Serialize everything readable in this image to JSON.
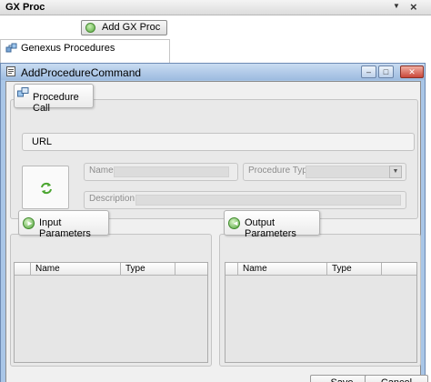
{
  "panel": {
    "title": "GX Proc",
    "menu_glyph": "▼",
    "close_glyph": "×",
    "add_button_label": "Add GX Proc",
    "tree_item": "Genexus Procedures"
  },
  "dialog": {
    "title": "AddProcedureCommand",
    "minimize_glyph": "–",
    "maximize_glyph": "□",
    "close_glyph": "✕",
    "procedure_call": {
      "tab_label": "Procedure Call",
      "url_label": "URL",
      "name_label": "Name",
      "name_value": "",
      "procedure_type_label": "Procedure Type",
      "procedure_type_value": "",
      "description_label": "Description",
      "description_value": ""
    },
    "input_parameters": {
      "tab_label": "Input Parameters",
      "columns": [
        "Name",
        "Type"
      ]
    },
    "output_parameters": {
      "tab_label": "Output Parameters",
      "columns": [
        "Name",
        "Type"
      ]
    },
    "buttons": {
      "save": "Save",
      "cancel": "Cancel"
    }
  },
  "icons": {
    "add": "add-circle-icon",
    "tree": "procedures-icon",
    "dialog": "command-icon",
    "refresh": "refresh-icon",
    "input": "arrow-right-icon",
    "output": "arrow-left-icon"
  },
  "colors": {
    "dialog_frame": "#a9c6e7",
    "dialog_client": "#f0f0f0",
    "close_button": "#c9473a",
    "tab_icon_green": "#52a43b"
  }
}
